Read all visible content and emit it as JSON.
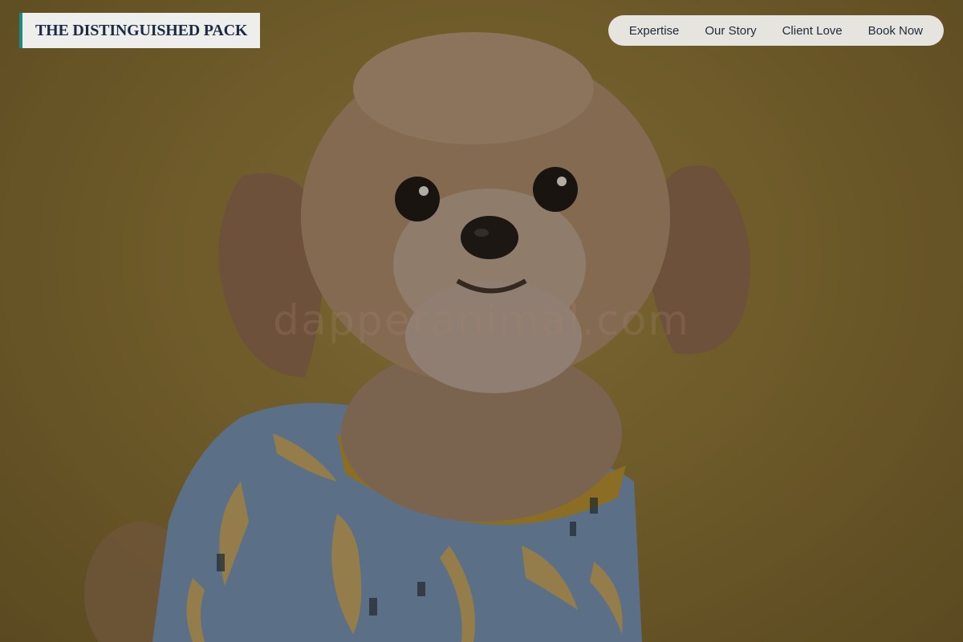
{
  "brand": {
    "name": "THE DISTINGUISHED PACK",
    "accent_color": "#1f8a83"
  },
  "nav": {
    "items": [
      {
        "label": "Expertise"
      },
      {
        "label": "Our Story"
      },
      {
        "label": "Client Love"
      },
      {
        "label": "Book Now"
      }
    ]
  },
  "hero": {
    "image_subject": "small fluffy dog wearing a blue banana-print shirt against a mustard background",
    "watermark": "dapperanimal.com",
    "background_color": "#8a7232"
  }
}
